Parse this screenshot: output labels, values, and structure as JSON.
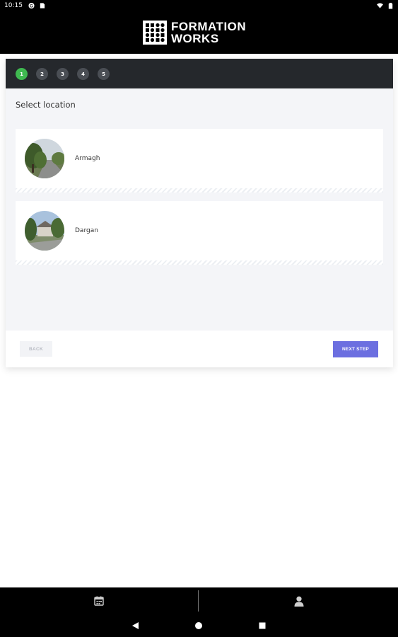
{
  "status_bar": {
    "time": "10:15",
    "icons_left": [
      "google-icon",
      "sim-card-icon"
    ],
    "icons_right": [
      "wifi-icon",
      "battery-icon"
    ]
  },
  "header": {
    "logo_line1": "FORMATION",
    "logo_line2": "WORKS"
  },
  "stepper": {
    "steps": [
      "1",
      "2",
      "3",
      "4",
      "5"
    ],
    "active_step": "1"
  },
  "main": {
    "title": "Select location",
    "locations": [
      {
        "name": "Armagh",
        "image": "tree-lined-road-photo"
      },
      {
        "name": "Dargan",
        "image": "house-with-trees-photo"
      }
    ]
  },
  "footer": {
    "back_label": "BACK",
    "next_label": "NEXT STEP"
  },
  "tab_bar": {
    "tabs": [
      "calendar-icon",
      "person-icon"
    ]
  },
  "nav_bar": {
    "buttons": [
      "back-triangle-icon",
      "home-circle-icon",
      "recents-square-icon"
    ]
  },
  "colors": {
    "active_step": "#3fb950",
    "primary_button": "#6c6fe0",
    "stepper_bg": "#25282c",
    "header_bg": "#000000"
  }
}
